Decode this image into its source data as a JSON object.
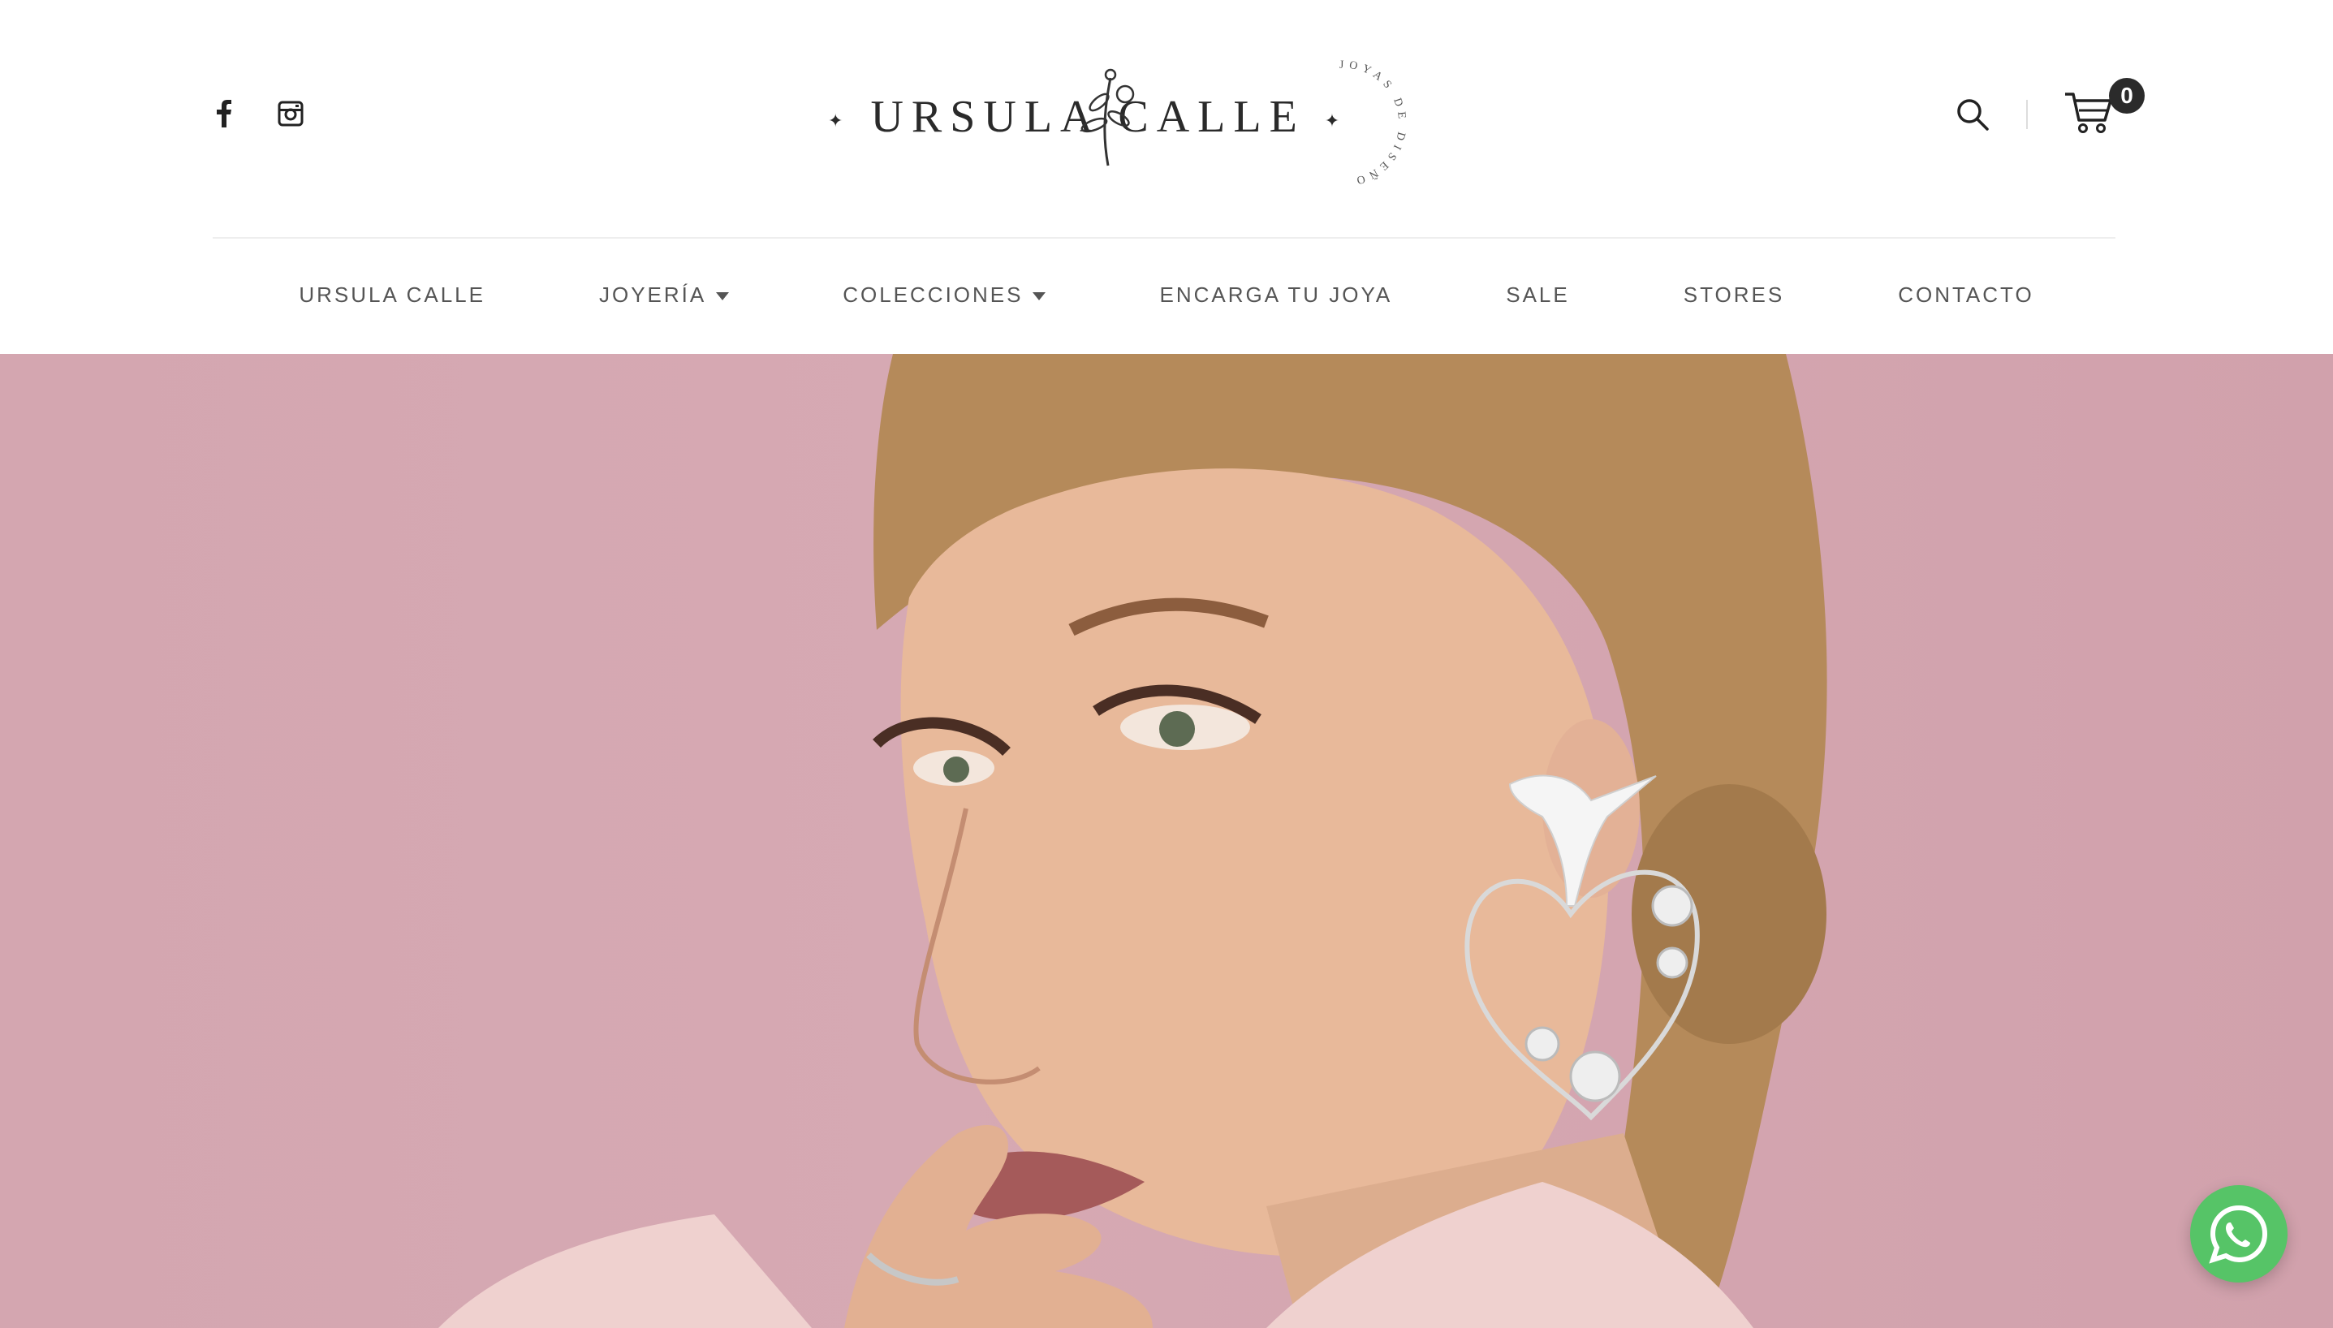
{
  "brand": {
    "name": "URSULA CALLE",
    "tagline": "JOYAS DE DISEÑO"
  },
  "social": [
    "facebook-icon",
    "instagram-icon"
  ],
  "header": {
    "search_icon": "search-icon",
    "cart_icon": "cart-icon",
    "cart_count": "0"
  },
  "nav": {
    "items": [
      {
        "label": "URSULA CALLE",
        "dropdown": false
      },
      {
        "label": "JOYERÍA",
        "dropdown": true
      },
      {
        "label": "COLECCIONES",
        "dropdown": true
      },
      {
        "label": "ENCARGA TU JOYA",
        "dropdown": false
      },
      {
        "label": "SALE",
        "dropdown": false
      },
      {
        "label": "STORES",
        "dropdown": false
      },
      {
        "label": "CONTACTO",
        "dropdown": false
      }
    ]
  },
  "hero": {
    "background": "#d4a6b0",
    "skin": "#e8b99a",
    "hair": "#b58a5a",
    "lips": "#a55a5a",
    "jacket": "#efd1cf"
  },
  "whatsapp": {
    "icon": "whatsapp-icon",
    "color": "#56c467"
  }
}
